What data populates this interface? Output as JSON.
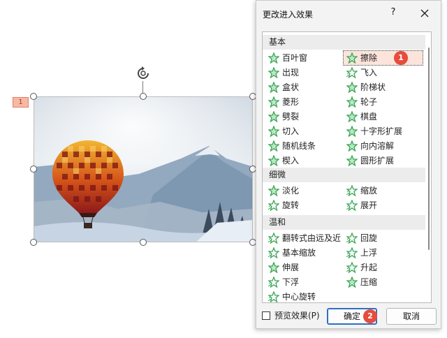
{
  "slide": {
    "anim_tag": "1"
  },
  "dialog": {
    "title": "更改进入效果",
    "help_label": "?",
    "groups": [
      {
        "name": "基本",
        "items": [
          {
            "label": "百叶窗",
            "icon": "star-solid"
          },
          {
            "label": "擦除",
            "icon": "star-solid",
            "selected": true
          },
          {
            "label": "出现",
            "icon": "star-solid"
          },
          {
            "label": "飞入",
            "icon": "star-motion"
          },
          {
            "label": "盒状",
            "icon": "star-solid"
          },
          {
            "label": "阶梯状",
            "icon": "star-solid"
          },
          {
            "label": "菱形",
            "icon": "star-solid"
          },
          {
            "label": "轮子",
            "icon": "star-solid"
          },
          {
            "label": "劈裂",
            "icon": "star-solid"
          },
          {
            "label": "棋盘",
            "icon": "star-solid"
          },
          {
            "label": "切入",
            "icon": "star-solid"
          },
          {
            "label": "十字形扩展",
            "icon": "star-solid"
          },
          {
            "label": "随机线条",
            "icon": "star-solid"
          },
          {
            "label": "向内溶解",
            "icon": "star-solid"
          },
          {
            "label": "楔入",
            "icon": "star-solid"
          },
          {
            "label": "圆形扩展",
            "icon": "star-solid"
          }
        ]
      },
      {
        "name": "细微",
        "items": [
          {
            "label": "淡化",
            "icon": "star-solid"
          },
          {
            "label": "缩放",
            "icon": "star-motion"
          },
          {
            "label": "旋转",
            "icon": "star-motion"
          },
          {
            "label": "展开",
            "icon": "star-motion"
          }
        ]
      },
      {
        "name": "温和",
        "items": [
          {
            "label": "翻转式由远及近",
            "icon": "star-motion"
          },
          {
            "label": "回旋",
            "icon": "star-motion"
          },
          {
            "label": "基本缩放",
            "icon": "star-motion"
          },
          {
            "label": "上浮",
            "icon": "star-motion"
          },
          {
            "label": "伸展",
            "icon": "star-solid"
          },
          {
            "label": "升起",
            "icon": "star-motion"
          },
          {
            "label": "下浮",
            "icon": "star-motion"
          },
          {
            "label": "压缩",
            "icon": "star-solid"
          },
          {
            "label": "中心旋转",
            "icon": "star-motion"
          }
        ]
      }
    ],
    "preview_label": "预览效果(P)",
    "preview_checked": false,
    "ok_label": "确定",
    "cancel_label": "取消",
    "step_badges": [
      "1",
      "2"
    ]
  },
  "colors": {
    "star_green": "#3aa655",
    "badge_red": "#e74c3c",
    "selected_bg": "#fde4db"
  }
}
